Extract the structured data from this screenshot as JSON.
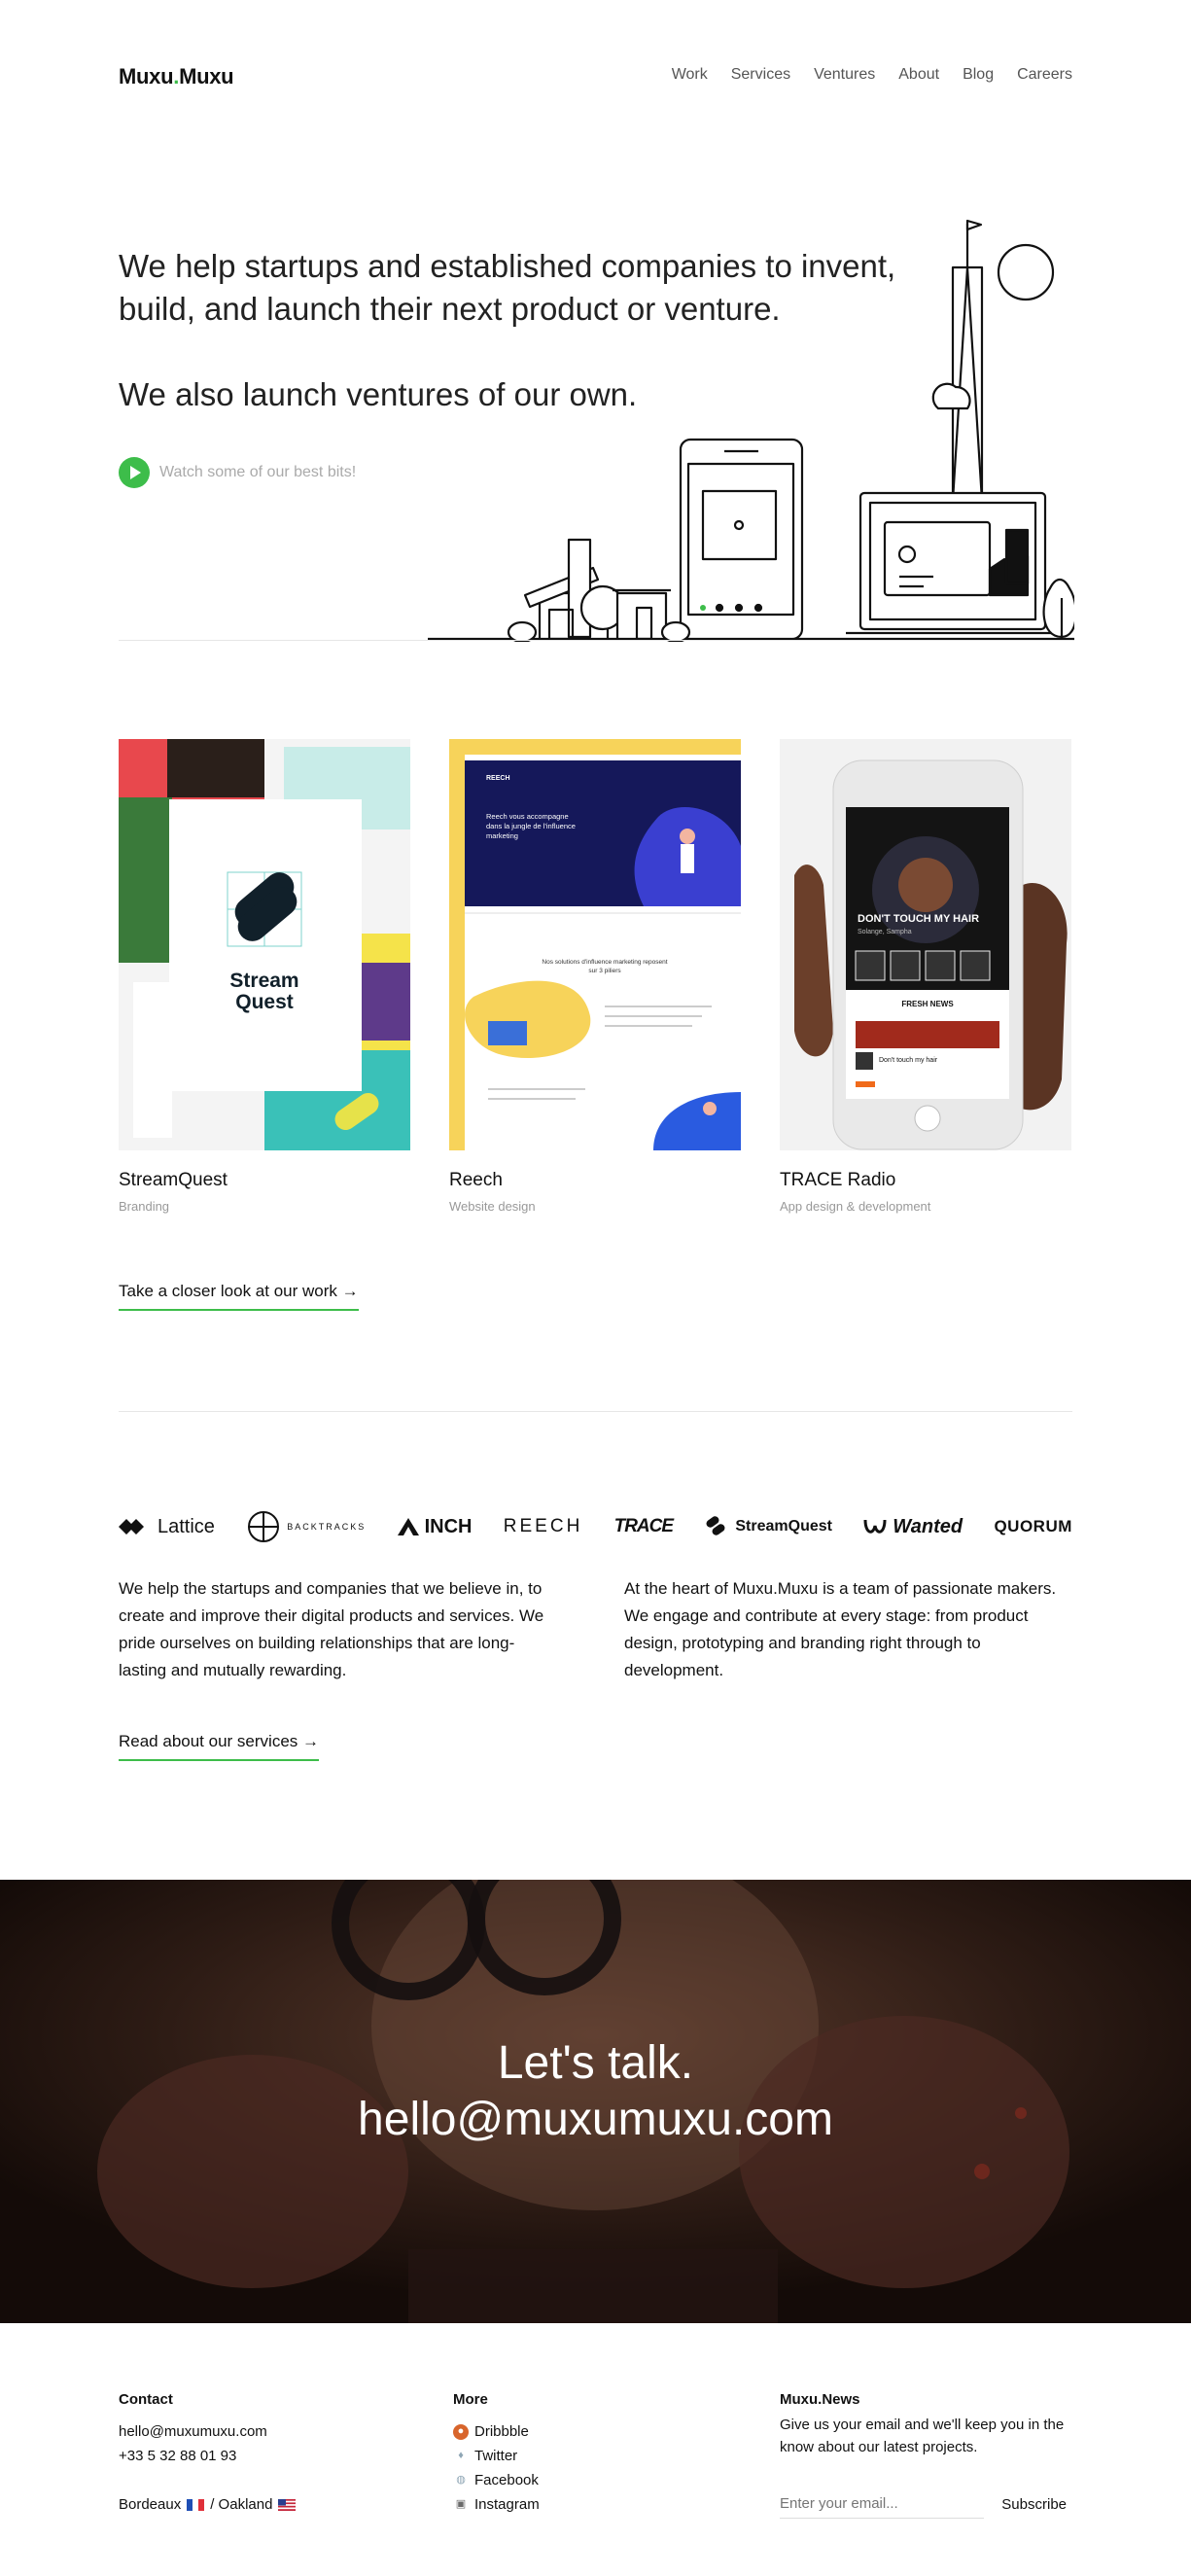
{
  "brand": {
    "name_a": "Muxu",
    "name_dot": ".",
    "name_b": "Muxu",
    "accent": "#3dbd4a"
  },
  "nav": [
    "Work",
    "Services",
    "Ventures",
    "About",
    "Blog",
    "Careers"
  ],
  "hero": {
    "line1": "We help startups and established companies to invent, build, and launch their next product or venture.",
    "line2": "We also launch ventures of our own.",
    "watch": "Watch some of our best bits!"
  },
  "work": [
    {
      "title": "StreamQuest",
      "subtitle": "Branding",
      "thumb_word_a": "Stream",
      "thumb_word_b": "Quest"
    },
    {
      "title": "Reech",
      "subtitle": "Website design",
      "thumb_brand": "REECH",
      "thumb_headline": "Reech vous accompagne dans la jungle de l'influence marketing",
      "thumb_section": "Nos solutions d'influence marketing reposent sur 3 piliers"
    },
    {
      "title": "TRACE Radio",
      "subtitle": "App design & development",
      "thumb_song": "DON'T TOUCH MY HAIR",
      "thumb_artist": "Solange, Sampha",
      "thumb_news": "FRESH NEWS",
      "thumb_item": "Don't touch my hair"
    }
  ],
  "work_cta": "Take a closer look at our work →",
  "clients": [
    "Lattice",
    "BACKTRACKS",
    "INCH",
    "REECH",
    "TRACE",
    "StreamQuest",
    "Wanted",
    "QUORUM"
  ],
  "about": {
    "left": "We help the startups and companies that we believe in, to create and improve their digital products and services. We pride ourselves on building relationships that are long-lasting and mutually rewarding.",
    "right": "At the heart of Muxu.Muxu is a team of passionate makers. We engage and contribute at every stage: from product design, prototyping and branding right through to development."
  },
  "services_cta": "Read about our services →",
  "talk": {
    "line1": "Let's talk.",
    "line2": "hello@muxumuxu.com"
  },
  "footer": {
    "contact": {
      "heading": "Contact",
      "email": "hello@muxumuxu.com",
      "phone": "+33 5 32 88 01 93",
      "city1": "Bordeaux",
      "city2": "/ Oakland"
    },
    "more": {
      "heading": "More",
      "links": [
        {
          "label": "Dribbble",
          "icon": "basketball-icon"
        },
        {
          "label": "Twitter",
          "icon": "bird-icon"
        },
        {
          "label": "Facebook",
          "icon": "speech-bubble-icon"
        },
        {
          "label": "Instagram",
          "icon": "camera-icon"
        }
      ]
    },
    "news": {
      "heading": "Muxu.News",
      "text": "Give us your email and we'll keep you in the know about our latest projects.",
      "placeholder": "Enter your email...",
      "button": "Subscribe"
    }
  }
}
